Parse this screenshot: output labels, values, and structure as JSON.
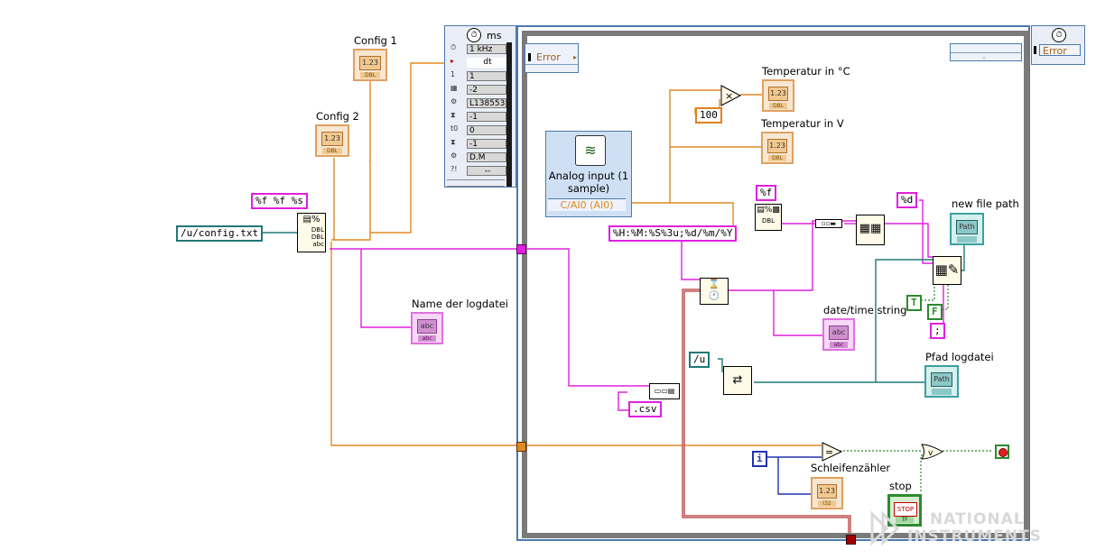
{
  "labels": {
    "config1": "Config 1",
    "config2": "Config 2",
    "name_logdatei": "Name der logdatei",
    "temp_c": "Temperatur in °C",
    "temp_v": "Temperatur in V",
    "new_file_path": "new file path",
    "date_time_string": "date/time string",
    "pfad_logdatei": "Pfad logdatei",
    "schleifenzaehler": "Schleifenzähler",
    "stop": "stop"
  },
  "constants": {
    "format": "%f %f %s",
    "config_path": "/u/config.txt",
    "pct_f": "%f",
    "time_format": "%H:%M:%S%3u;%d/%m/%Y",
    "pct_d": "%d",
    "hundred": "100",
    "u_path": "/u",
    "csv": ".csv",
    "true_const": "T",
    "false_const": "F",
    "semicolon": ";",
    "loop_i": "i"
  },
  "timing": {
    "header_unit": "ms",
    "rows": [
      {
        "key": "⏱",
        "value": "1 kHz"
      },
      {
        "key": "▸",
        "value": "dt"
      },
      {
        "key": "1",
        "value": "1"
      },
      {
        "key": "▦",
        "value": "-2"
      },
      {
        "key": "⚙",
        "value": "L138553"
      },
      {
        "key": "⧗",
        "value": "-1"
      },
      {
        "key": "t0",
        "value": "0"
      },
      {
        "key": "⧗",
        "value": "-1"
      },
      {
        "key": "⚙",
        "value": "D.M"
      },
      {
        "key": "?!",
        "value": "--"
      }
    ]
  },
  "error_clusters": {
    "left": "Error",
    "right": "Error"
  },
  "express_vi": {
    "title": "Analog input (1 sample)",
    "channel": "C/AI0 (AI0)"
  },
  "indicator_tags": {
    "dbl": "DBL",
    "abc": "abc",
    "path": "Path",
    "num_display": "1.23",
    "i32": "I32",
    "stop_text": "STOP",
    "tf": "TF"
  },
  "watermark": {
    "line1": "NATIONAL",
    "line2": "INSTRUMENTS"
  },
  "colors": {
    "orange_wire": "#e08a20",
    "pink_wire": "#e020e0",
    "teal_wire": "#207878",
    "blue_wire": "#2030b0",
    "green_wire": "#2a8a2a",
    "error_wire": "#a00000",
    "loop_frame": "#6a6a6a"
  }
}
